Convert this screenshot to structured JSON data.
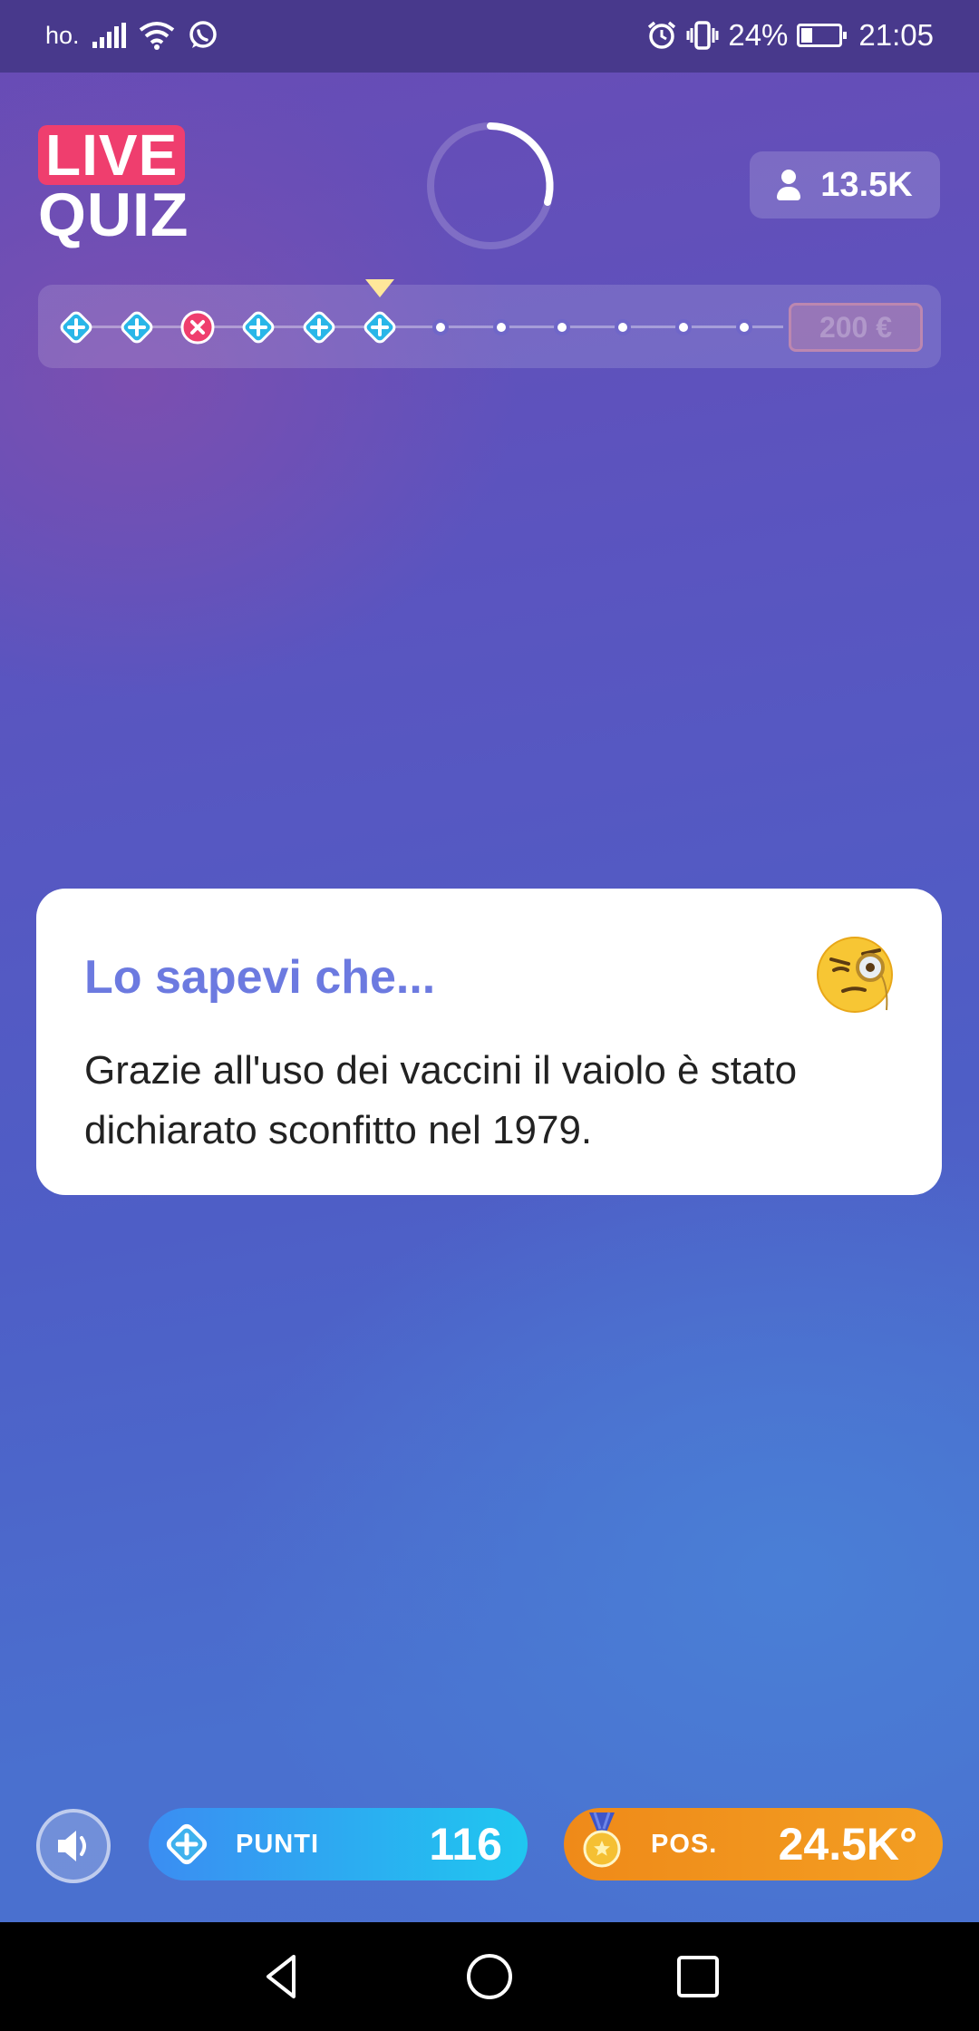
{
  "status_bar": {
    "carrier": "ho.",
    "battery_percent": "24%",
    "time": "21:05",
    "icons": [
      "signal-icon",
      "wifi-icon",
      "whatsapp-icon",
      "alarm-icon",
      "vibrate-icon",
      "battery-icon"
    ]
  },
  "header": {
    "logo_top": "LIVE",
    "logo_bottom": "QUIZ",
    "players_count": "13.5K"
  },
  "progress": {
    "steps": [
      "correct",
      "correct",
      "wrong",
      "correct",
      "correct",
      "correct",
      "pending",
      "pending",
      "pending",
      "pending",
      "pending",
      "pending"
    ],
    "current_step": 6,
    "prize": "200 €"
  },
  "fact_card": {
    "title": "Lo sapevi che...",
    "text": "Grazie all'uso dei vaccini il vaiolo è stato dichiarato sconfitto nel 1979.",
    "emoji": "monocle-face-icon"
  },
  "bottom_bar": {
    "points_label": "PUNTI",
    "points_value": "116",
    "position_label": "POS.",
    "position_value": "24.5K°"
  },
  "colors": {
    "accent_live": "#ef3e6e",
    "title_blue": "#6c7ae0",
    "points_pill": "#2fa8f2",
    "position_pill": "#f0901c",
    "correct_step": "#29b6e8",
    "wrong_step": "#ef3e6e",
    "marker": "#ffe79a"
  }
}
